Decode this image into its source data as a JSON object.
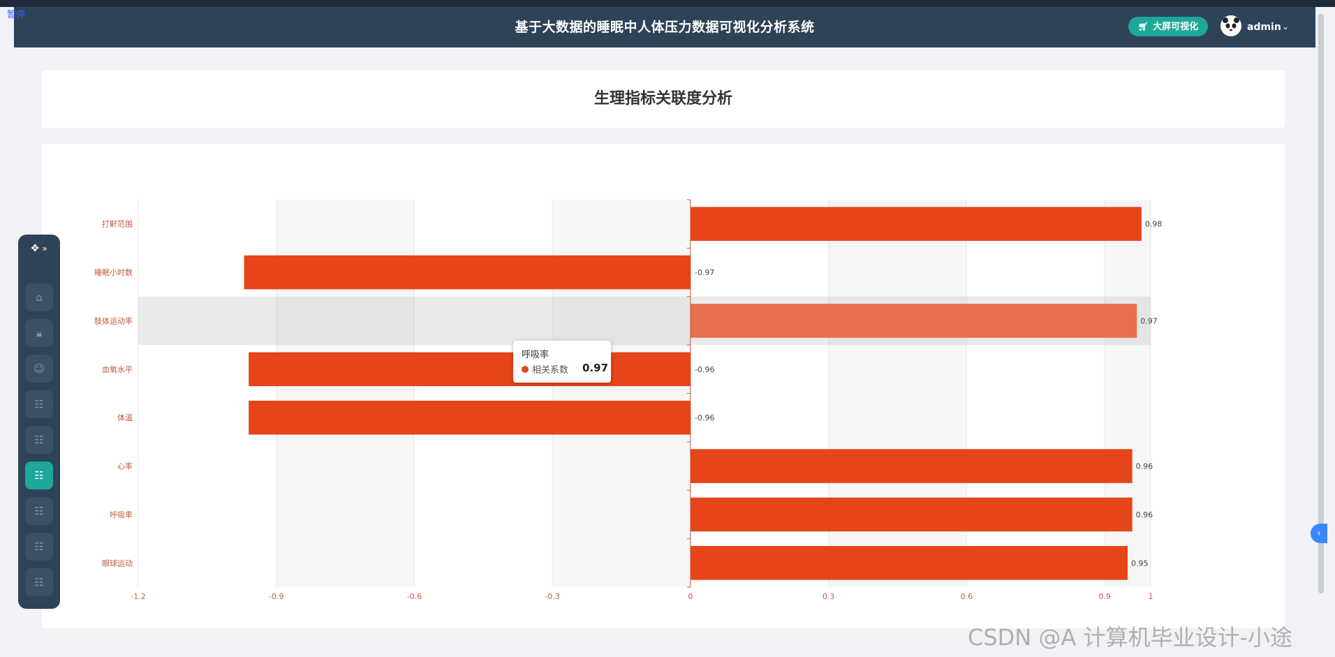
{
  "overlay": {
    "pause_label": "暂停"
  },
  "header": {
    "title": "基于大数据的睡眠中人体压力数据可视化分析系统",
    "bigscreen_button": "大屏可视化",
    "username": "admin"
  },
  "page": {
    "title": "生理指标关联度分析"
  },
  "sidebar": {
    "items": [
      {
        "icon": "home-icon"
      },
      {
        "icon": "lock-icon"
      },
      {
        "icon": "user-icon"
      },
      {
        "icon": "grid-icon"
      },
      {
        "icon": "grid-icon"
      },
      {
        "icon": "grid-icon",
        "active": true
      },
      {
        "icon": "grid-icon"
      },
      {
        "icon": "grid-icon"
      },
      {
        "icon": "grid-icon"
      }
    ]
  },
  "tooltip": {
    "title": "呼吸率",
    "series_label": "相关系数",
    "value": "0.97"
  },
  "watermark": "CSDN @A 计算机毕业设计-小途",
  "colors": {
    "header_bg": "#2e4258",
    "accent": "#1ea89c",
    "bar": "#e64419",
    "bar_hover": "#e86f4e",
    "axis_label": "#c55a3a"
  },
  "chart_data": {
    "type": "bar",
    "orientation": "horizontal",
    "categories": [
      "打鼾范围",
      "睡眠小时数",
      "肢体运动率",
      "血氧水平",
      "体温",
      "心率",
      "呼吸率",
      "眼球运动"
    ],
    "series": [
      {
        "name": "相关系数",
        "values": [
          0.98,
          -0.97,
          0.97,
          -0.96,
          -0.96,
          0.96,
          0.96,
          0.95
        ]
      }
    ],
    "x_ticks": [
      -1.2,
      -0.9,
      -0.6,
      -0.3,
      0,
      0.3,
      0.6,
      0.9,
      1
    ],
    "xlim": [
      -1.2,
      1
    ],
    "highlighted_category": "肢体运动率"
  }
}
